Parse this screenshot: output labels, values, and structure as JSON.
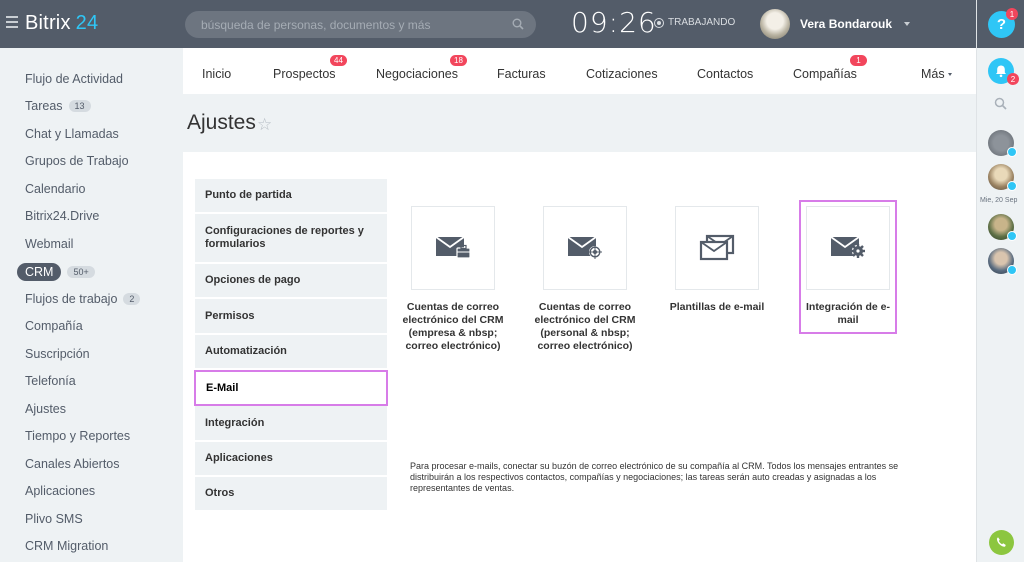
{
  "topbar": {
    "logo_name": "Bitrix",
    "logo_num": "24",
    "search_placeholder": "búsqueda de personas, documentos y más",
    "clock": "09:26",
    "work_status": "TRABAJANDO",
    "user_name": "Vera Bondarouk"
  },
  "rightpanel": {
    "help_label": "?",
    "help_badge": "1",
    "bell_badge": "2",
    "date_label": "Mie, 20 Sep"
  },
  "sidebar": {
    "items": [
      {
        "label": "Flujo de Actividad"
      },
      {
        "label": "Tareas",
        "count": "13"
      },
      {
        "label": "Chat y Llamadas"
      },
      {
        "label": "Grupos de Trabajo"
      },
      {
        "label": "Calendario"
      },
      {
        "label": "Bitrix24.Drive"
      },
      {
        "label": "Webmail"
      },
      {
        "label": "CRM",
        "count": "50+"
      },
      {
        "label": "Flujos de trabajo",
        "count": "2"
      },
      {
        "label": "Compañía"
      },
      {
        "label": "Suscripción"
      },
      {
        "label": "Telefonía"
      },
      {
        "label": "Ajustes"
      },
      {
        "label": "Tiempo y Reportes"
      },
      {
        "label": "Canales Abiertos"
      },
      {
        "label": "Aplicaciones"
      },
      {
        "label": "Plivo SMS"
      },
      {
        "label": "CRM Migration"
      }
    ]
  },
  "tabs": [
    {
      "label": "Inicio"
    },
    {
      "label": "Prospectos",
      "badge": "44"
    },
    {
      "label": "Negociaciones",
      "badge": "18"
    },
    {
      "label": "Facturas"
    },
    {
      "label": "Cotizaciones"
    },
    {
      "label": "Contactos"
    },
    {
      "label": "Compañías",
      "badge": "1"
    },
    {
      "label": "Más"
    }
  ],
  "page": {
    "title": "Ajustes",
    "star": "☆"
  },
  "settings_nav": [
    {
      "label": "Punto de partida"
    },
    {
      "label": "Configuraciones de reportes y formularios"
    },
    {
      "label": "Opciones de pago"
    },
    {
      "label": "Permisos"
    },
    {
      "label": "Automatización"
    },
    {
      "label": "E-Mail",
      "selected": true
    },
    {
      "label": "Integración"
    },
    {
      "label": "Aplicaciones"
    },
    {
      "label": "Otros"
    }
  ],
  "tiles": [
    {
      "label": "Cuentas de correo electrónico del CRM (empresa & nbsp; correo electrónico)",
      "icon": "mail-briefcase-icon"
    },
    {
      "label": "Cuentas de correo electrónico del CRM (personal & nbsp; correo electrónico)",
      "icon": "mail-target-icon"
    },
    {
      "label": "Plantillas de e-mail",
      "icon": "mail-templates-icon"
    },
    {
      "label": "Integración de e-mail",
      "icon": "mail-gear-icon",
      "highlighted": true
    }
  ],
  "info_text": "Para procesar e-mails, conectar su buzón de correo electrónico de su compañía al CRM. Todos los mensajes entrantes se distribuirán a los respectivos contactos, compañías y negociaciones; las tareas serán auto creadas y asignadas a los representantes de ventas.",
  "colors": {
    "topbar": "#535c69",
    "accent": "#2fc6f6",
    "badge": "#f2465c",
    "highlight": "#d77ce8",
    "phone": "#8cc63f"
  }
}
